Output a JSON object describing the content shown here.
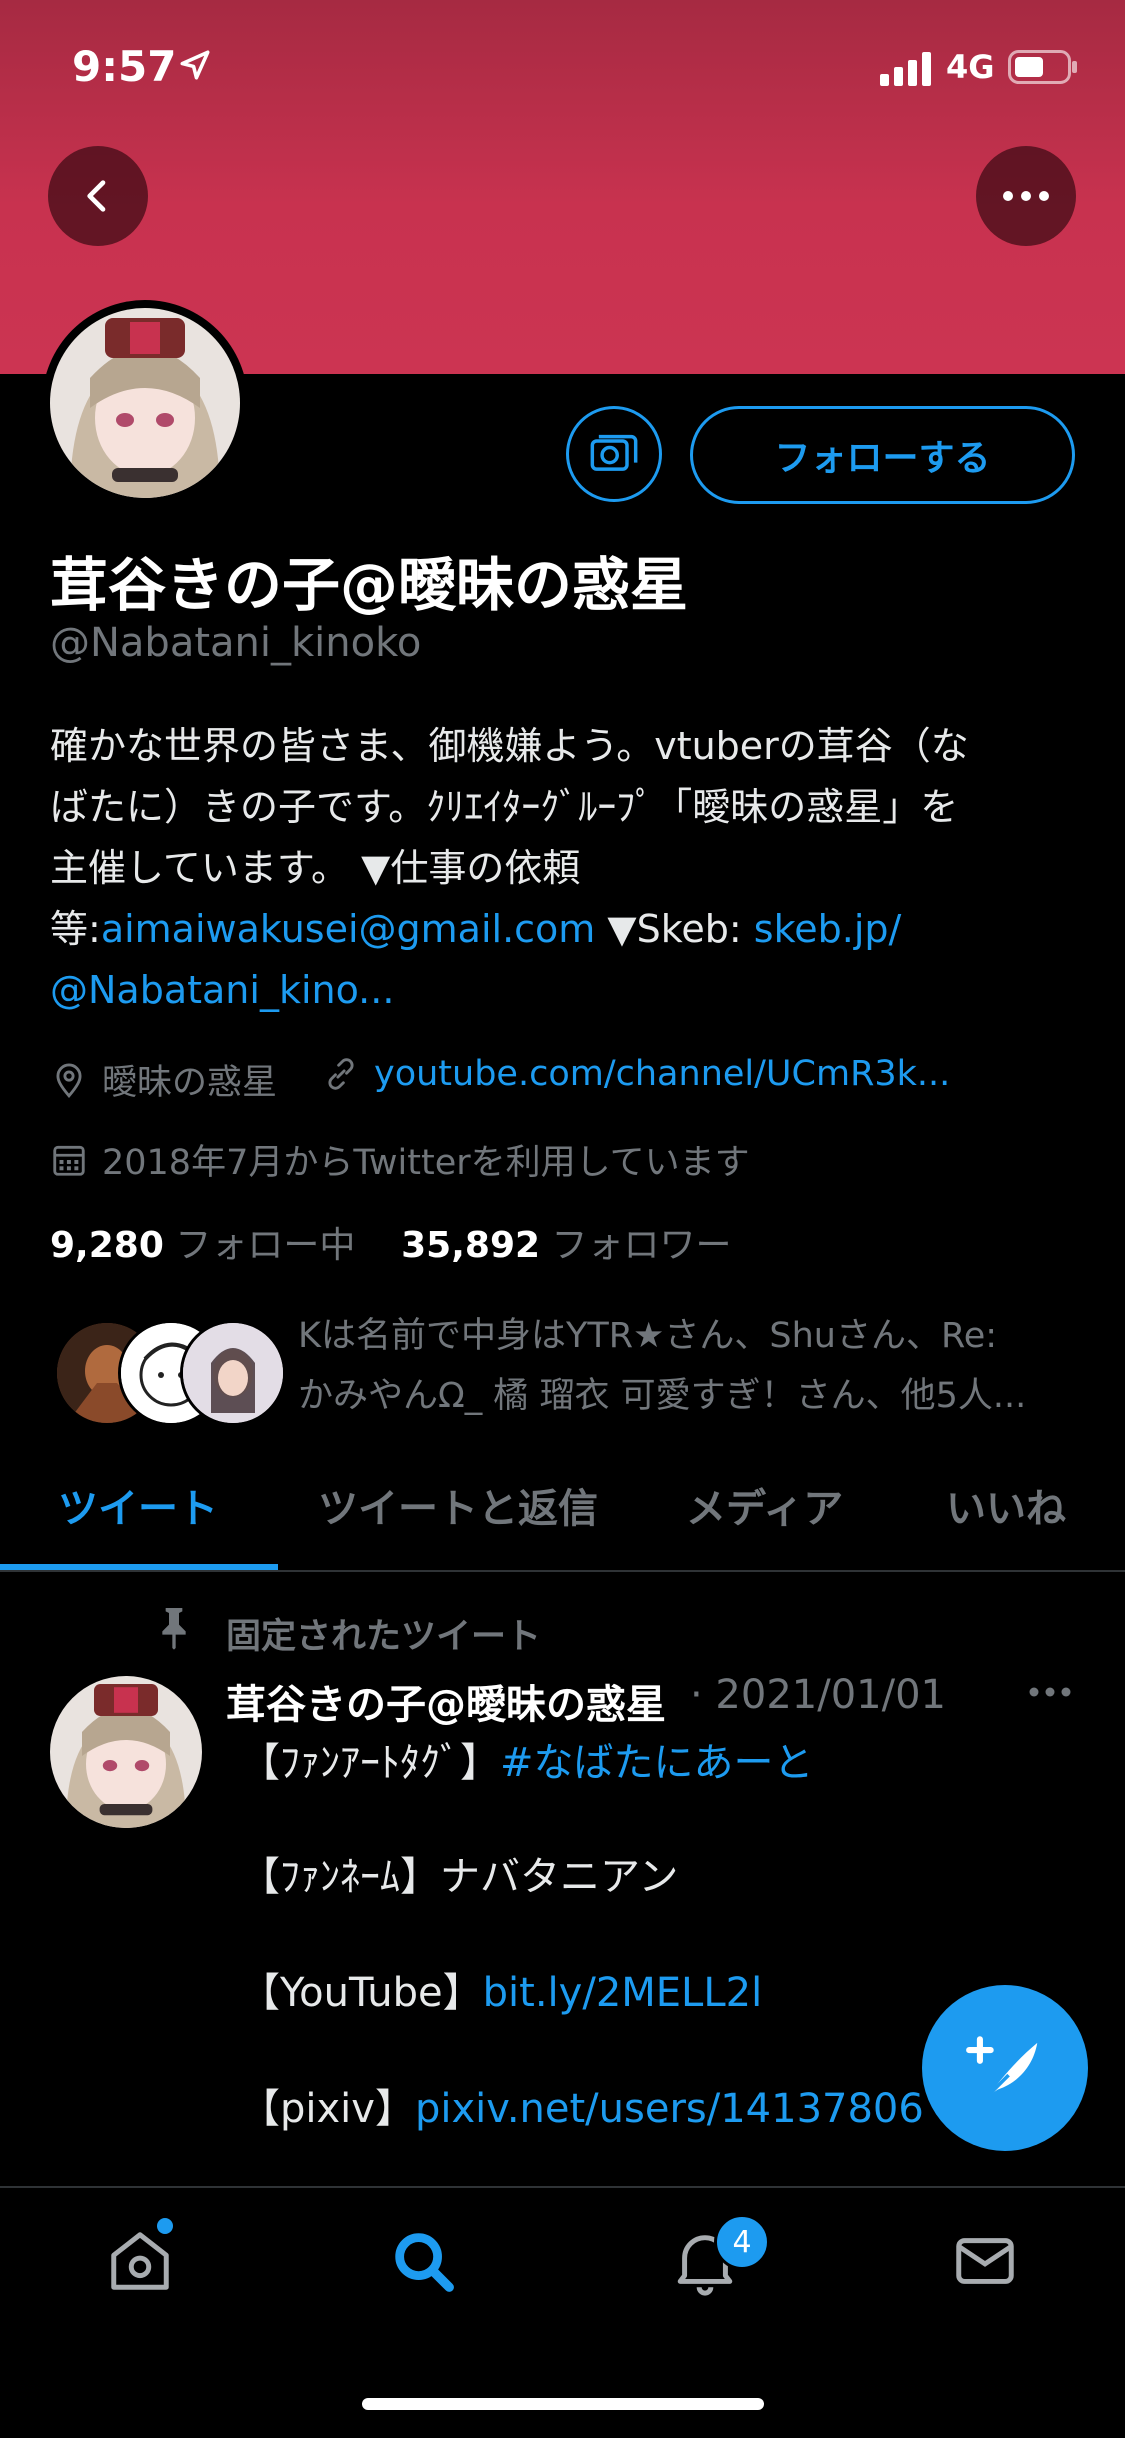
{
  "status": {
    "time": "9:57",
    "network": "4G"
  },
  "profile": {
    "name": "茸谷きの子@曖昧の惑星",
    "handle": "@Nabatani_kinoko",
    "follow_label": "フォローする",
    "bio_line1": "確かな世界の皆さま、御機嫌よう。vtuberの茸谷（な",
    "bio_line2": "ばたに）きの子です。ｸﾘｴｲﾀｰｸﾞﾙｰﾌﾟ「曖昧の惑星」を",
    "bio_line3": "主催しています。 ▼仕事の依頼",
    "bio_prefix4": "等:",
    "bio_email": "aimaiwakusei@gmail.com",
    "bio_skeb_label": " ▼Skeb: ",
    "bio_skeb_link": "skeb.jp/",
    "bio_line5": "@Nabatani_kino...",
    "location": "曖昧の惑星",
    "website": "youtube.com/channel/UCmR3k...",
    "joined": "2018年7月からTwitterを利用しています",
    "following_count": "9,280",
    "following_label": "フォロー中",
    "followers_count": "35,892",
    "followers_label": "フォロワー",
    "followed_by_line1": "Kは名前で中身はYTR★さん、Shuさん、Re:",
    "followed_by_line2": "かみやんΩ_ 橘 瑠衣 可愛すぎ！さん、他5人..."
  },
  "tabs": [
    {
      "label": "ツイート",
      "active": true
    },
    {
      "label": "ツイートと返信"
    },
    {
      "label": "メディア"
    },
    {
      "label": "いいね"
    }
  ],
  "tweet": {
    "pinned_label": "固定されたツイート",
    "author": "茸谷きの子@曖昧の惑星",
    "date": "· 2021/01/01",
    "line1_prefix": "【ﾌｧﾝｱｰﾄﾀｸﾞ】",
    "line1_tag": "#なばたにあーと",
    "line2": "【ﾌｧﾝﾈｰﾑ】ナバタニアン",
    "line3_prefix": "【YouTube】",
    "line3_link": "bit.ly/2MELL2l",
    "line4_prefix": "【pixiv】",
    "line4_link": "pixiv.net/users/14137806"
  },
  "nav": {
    "notification_badge": "4"
  },
  "colors": {
    "accent": "#1d9bf0",
    "banner": "#c8324f",
    "background": "#000000",
    "muted": "#71767b"
  },
  "icons": [
    "back-icon",
    "more-icon",
    "camera-icon",
    "location-icon",
    "link-icon",
    "calendar-icon",
    "pin-icon",
    "compose-icon",
    "home-icon",
    "search-icon",
    "bell-icon",
    "mail-icon"
  ]
}
